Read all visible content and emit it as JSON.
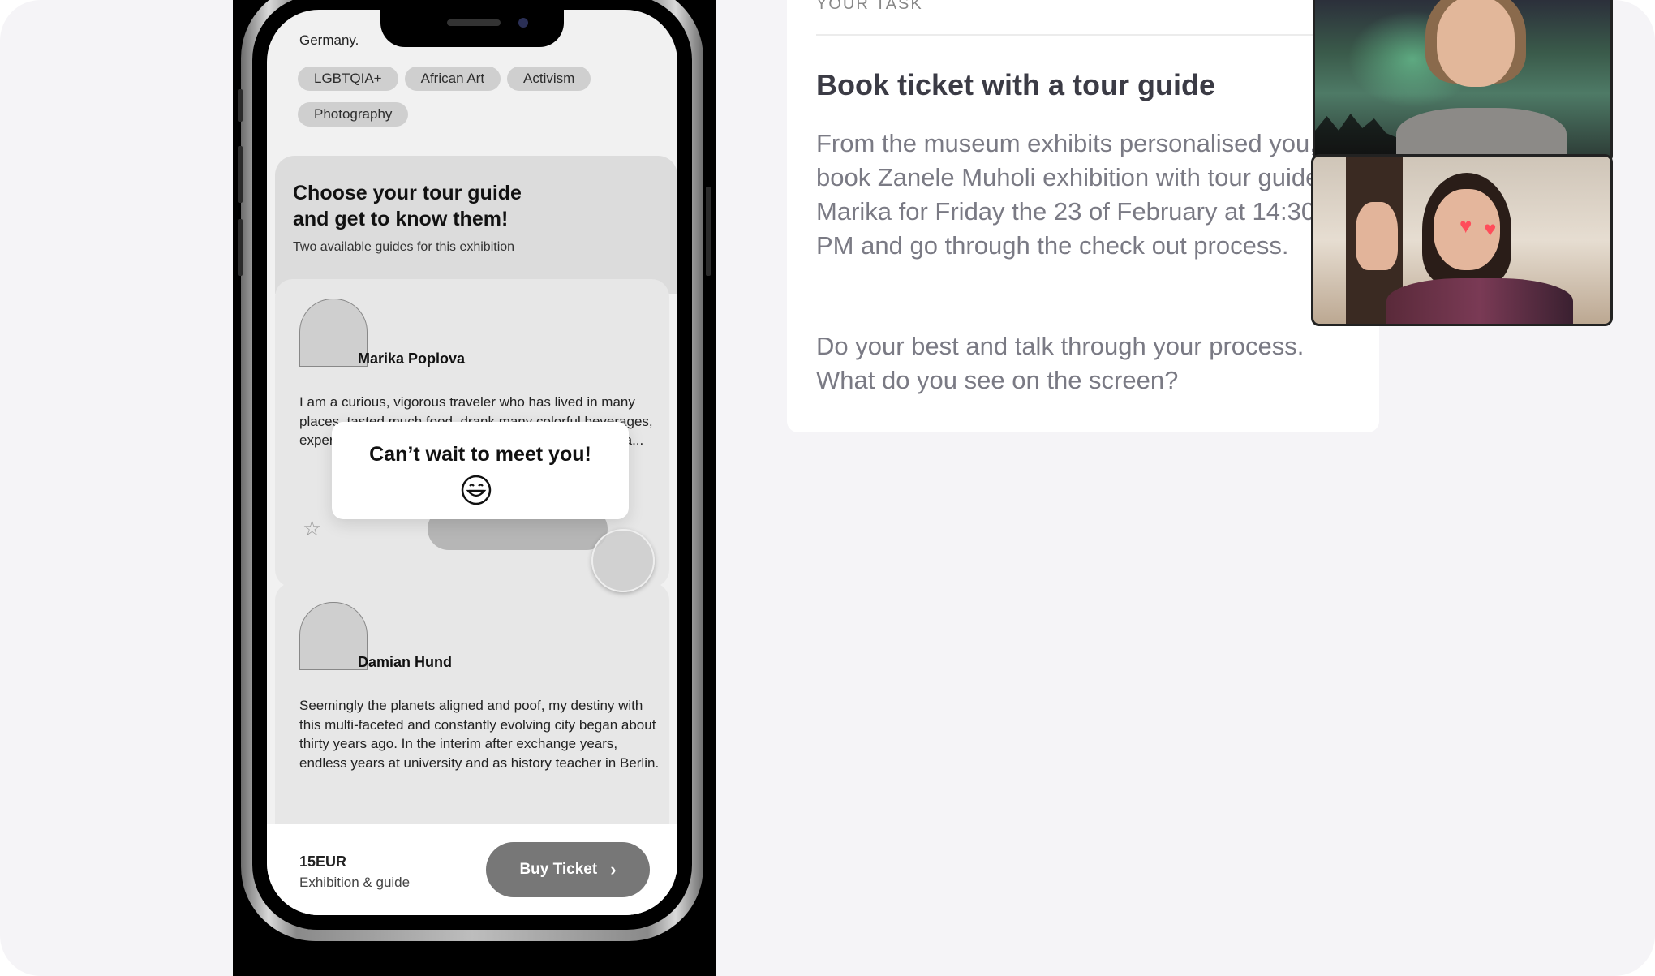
{
  "phone": {
    "country_partial": "Germany.",
    "tags": [
      "LGBTQIA+",
      "African Art",
      "Activism",
      "Photography"
    ],
    "intro": {
      "title": "Choose your tour guide and get to know them!",
      "subtitle": "Two available guides for this exhibition"
    },
    "guides": [
      {
        "name": "Marika Poplova",
        "bio": "I am a curious, vigorous traveler who has lived in many places, tasted much food, drank many colorful beverages, experienced various cultures. My ... life con... this grea..."
      },
      {
        "name": "Damian Hund",
        "bio": "Seemingly the planets aligned and poof, my destiny with this multi-faceted and constantly evolving city began about thirty years ago. In the interim after exchange years, endless years at university and as history teacher in Berlin."
      }
    ],
    "popup": {
      "message": "Can’t wait to meet you!",
      "emoji_icon": "grinning-face-icon"
    },
    "bottom_bar": {
      "price": "15EUR",
      "price_sub": "Exhibition & guide",
      "buy_label": "Buy Ticket",
      "buy_chevron": "›"
    }
  },
  "task": {
    "label": "YOUR TASK",
    "title": "Book ticket with a tour guide",
    "description": "From the museum exhibits personalised you, book Zanele Muholi exhibition with tour guide Marika for Friday the 23 of February at 14:30 PM and go through the check out process.",
    "prompt": "Do your best and talk through your process. What do you see on the screen?"
  },
  "video": {
    "tile1_icon": "participant-video-1",
    "tile2_icon": "participant-video-2",
    "reaction": "♥"
  },
  "colors": {
    "stage_bg": "#f5f4f7",
    "buy_button": "#777777",
    "task_title": "#3b3b45",
    "task_text": "#7a7a84",
    "heart": "#ff4d5a"
  }
}
